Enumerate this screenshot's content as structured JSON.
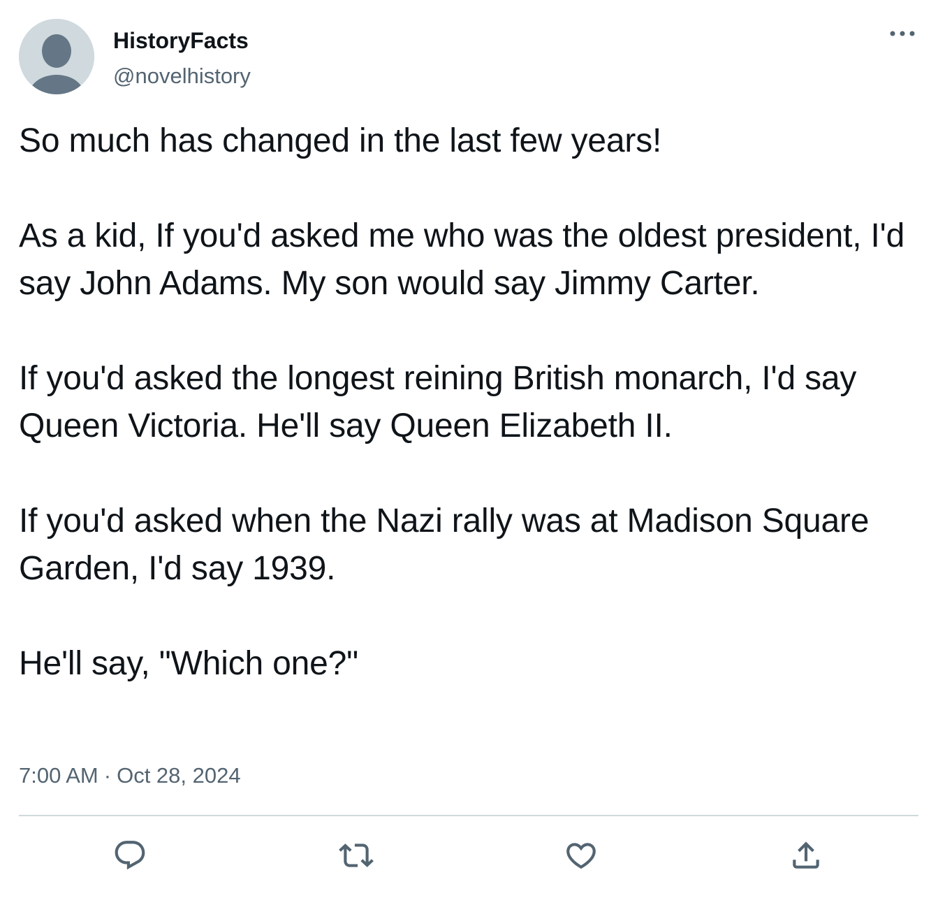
{
  "author": {
    "display_name": "HistoryFacts",
    "handle": "@novelhistory",
    "avatar_icon": "default-avatar-icon"
  },
  "tweet": {
    "paragraphs": [
      "So much has changed in the last few years!",
      "As a kid, If you'd asked me who was the oldest president, I'd say John Adams. My son would say Jimmy Carter.",
      "If you'd asked the longest reining British monarch, I'd say Queen Victoria. He'll say Queen Elizabeth II.",
      "If you'd asked when the Nazi rally was at Madison Square Garden, I'd say 1939.",
      "He'll say, \"Which one?\""
    ],
    "time": "7:00 AM",
    "separator": "·",
    "date": "Oct 28, 2024"
  },
  "actions": [
    {
      "name": "reply",
      "icon": "reply-icon"
    },
    {
      "name": "retweet",
      "icon": "retweet-icon"
    },
    {
      "name": "like",
      "icon": "heart-icon"
    },
    {
      "name": "share",
      "icon": "share-icon"
    }
  ],
  "colors": {
    "text": "#0f1419",
    "secondary_text": "#536471",
    "divider": "#cfd9de",
    "avatar_bg": "#cfd9de",
    "avatar_figure": "#657786"
  }
}
